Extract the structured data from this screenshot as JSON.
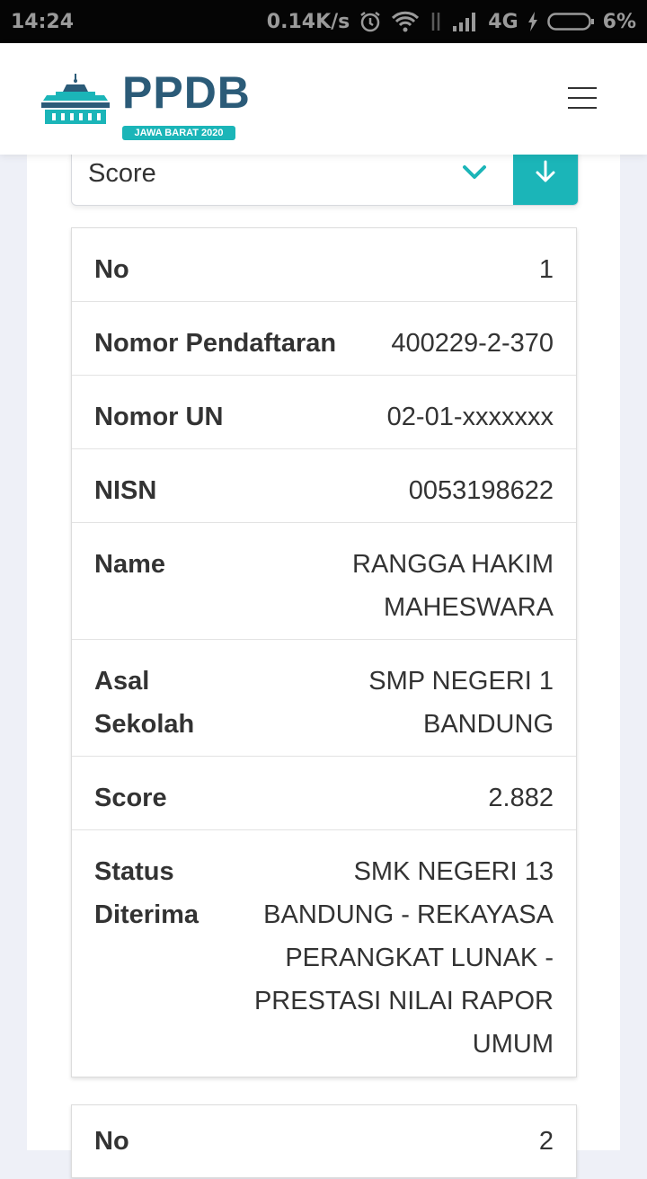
{
  "status_bar": {
    "time": "14:24",
    "speed": "0.14K/s",
    "network": "4G",
    "battery": "6%"
  },
  "header": {
    "logo_text": "PPDB",
    "logo_subtitle": "JAWA BARAT 2020",
    "menu_icon": "hamburger-icon"
  },
  "sort": {
    "selected": "Score",
    "chevron_icon": "chevron-down-icon",
    "direction_icon": "arrow-down-icon"
  },
  "colors": {
    "accent": "#1bb5b8",
    "brand": "#2b5b78"
  },
  "records": [
    {
      "fields": [
        {
          "label": "No",
          "value": "1"
        },
        {
          "label": "Nomor Pendaftaran",
          "value": "400229-2-370"
        },
        {
          "label": "Nomor UN",
          "value": "02-01-xxxxxxx"
        },
        {
          "label": "NISN",
          "value": "0053198622"
        },
        {
          "label": "Name",
          "value": "RANGGA HAKIM MAHESWARA"
        },
        {
          "label": "Asal Sekolah",
          "value": "SMP NEGERI 1 BANDUNG"
        },
        {
          "label": "Score",
          "value": "2.882"
        },
        {
          "label": "Status Diterima",
          "value": "SMK NEGERI 13 BANDUNG - REKAYASA PERANGKAT LUNAK - PRESTASI NILAI RAPOR UMUM"
        }
      ]
    },
    {
      "fields": [
        {
          "label": "No",
          "value": "2"
        }
      ]
    }
  ]
}
